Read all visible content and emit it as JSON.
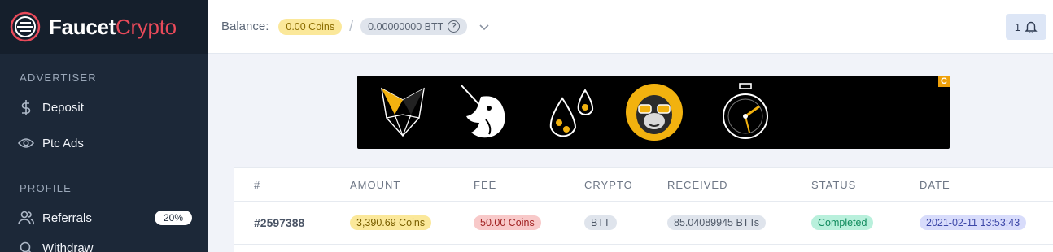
{
  "brand": {
    "name_a": "Faucet",
    "name_b": "Crypto"
  },
  "sidebar": {
    "sections": [
      {
        "title": "ADVERTISER"
      },
      {
        "title": "PROFILE"
      }
    ],
    "items": [
      {
        "label": "Deposit",
        "icon": "dollar-icon"
      },
      {
        "label": "Ptc Ads",
        "icon": "eye-icon"
      },
      {
        "label": "Referrals",
        "icon": "users-icon",
        "badge": "20%"
      },
      {
        "label": "Withdraw",
        "icon": "search-icon"
      }
    ]
  },
  "topbar": {
    "balance_label": "Balance:",
    "coins": "0.00 Coins",
    "btt": "0.00000000 BTT",
    "help_glyph": "?",
    "notifications_count": "1"
  },
  "banner": {
    "corner_badge": "C"
  },
  "table": {
    "headers": [
      "#",
      "AMOUNT",
      "FEE",
      "CRYPTO",
      "RECEIVED",
      "STATUS",
      "DATE"
    ],
    "rows": [
      {
        "id": "#2597388",
        "amount": "3,390.69 Coins",
        "fee": "50.00 Coins",
        "crypto": "BTT",
        "received": "85.04089945 BTTs",
        "status": "Completed",
        "date": "2021-02-11 13:53:43"
      }
    ]
  },
  "colors": {
    "sidebar_bg": "#1c2838",
    "brand_accent": "#e94a5a",
    "coins_badge": "#fbe89a",
    "status_completed": "#b9f0dc",
    "date_badge": "#d8dcfb"
  }
}
